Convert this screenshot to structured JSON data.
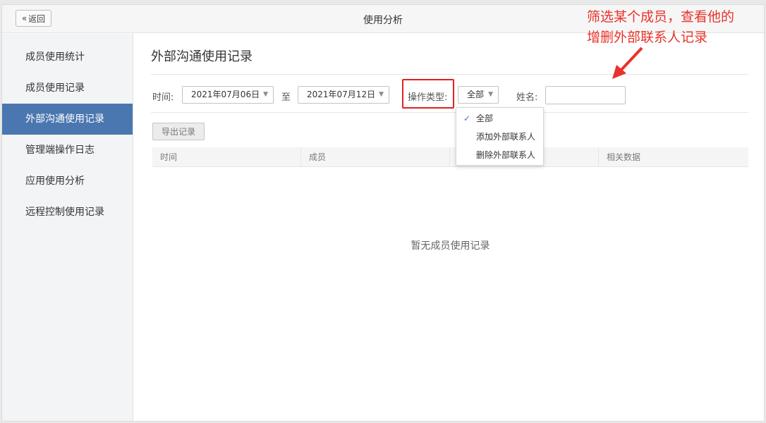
{
  "header": {
    "back_label": "返回",
    "title": "使用分析"
  },
  "sidebar": {
    "items": [
      {
        "label": "成员使用统计",
        "active": false
      },
      {
        "label": "成员使用记录",
        "active": false
      },
      {
        "label": "外部沟通使用记录",
        "active": true
      },
      {
        "label": "管理端操作日志",
        "active": false
      },
      {
        "label": "应用使用分析",
        "active": false
      },
      {
        "label": "远程控制使用记录",
        "active": false
      }
    ]
  },
  "main": {
    "title": "外部沟通使用记录",
    "filters": {
      "time_label": "时间:",
      "start_date": "2021年07月06日",
      "to_label": "至",
      "end_date": "2021年07月12日",
      "op_type_label": "操作类型:",
      "op_type_value": "全部",
      "name_label": "姓名:",
      "name_value": ""
    },
    "export_button": "导出记录",
    "table": {
      "columns": [
        "时间",
        "成员",
        "",
        "相关数据"
      ]
    },
    "empty_text": "暂无成员使用记录",
    "op_type_menu": {
      "options": [
        "全部",
        "添加外部联系人",
        "删除外部联系人"
      ],
      "selected": "全部"
    }
  },
  "annotation": {
    "line1": "筛选某个成员，查看他的",
    "line2": "增删外部联系人记录"
  },
  "colors": {
    "accent": "#4a77b0",
    "annotation": "#e8332a",
    "highlight": "#e02020"
  }
}
